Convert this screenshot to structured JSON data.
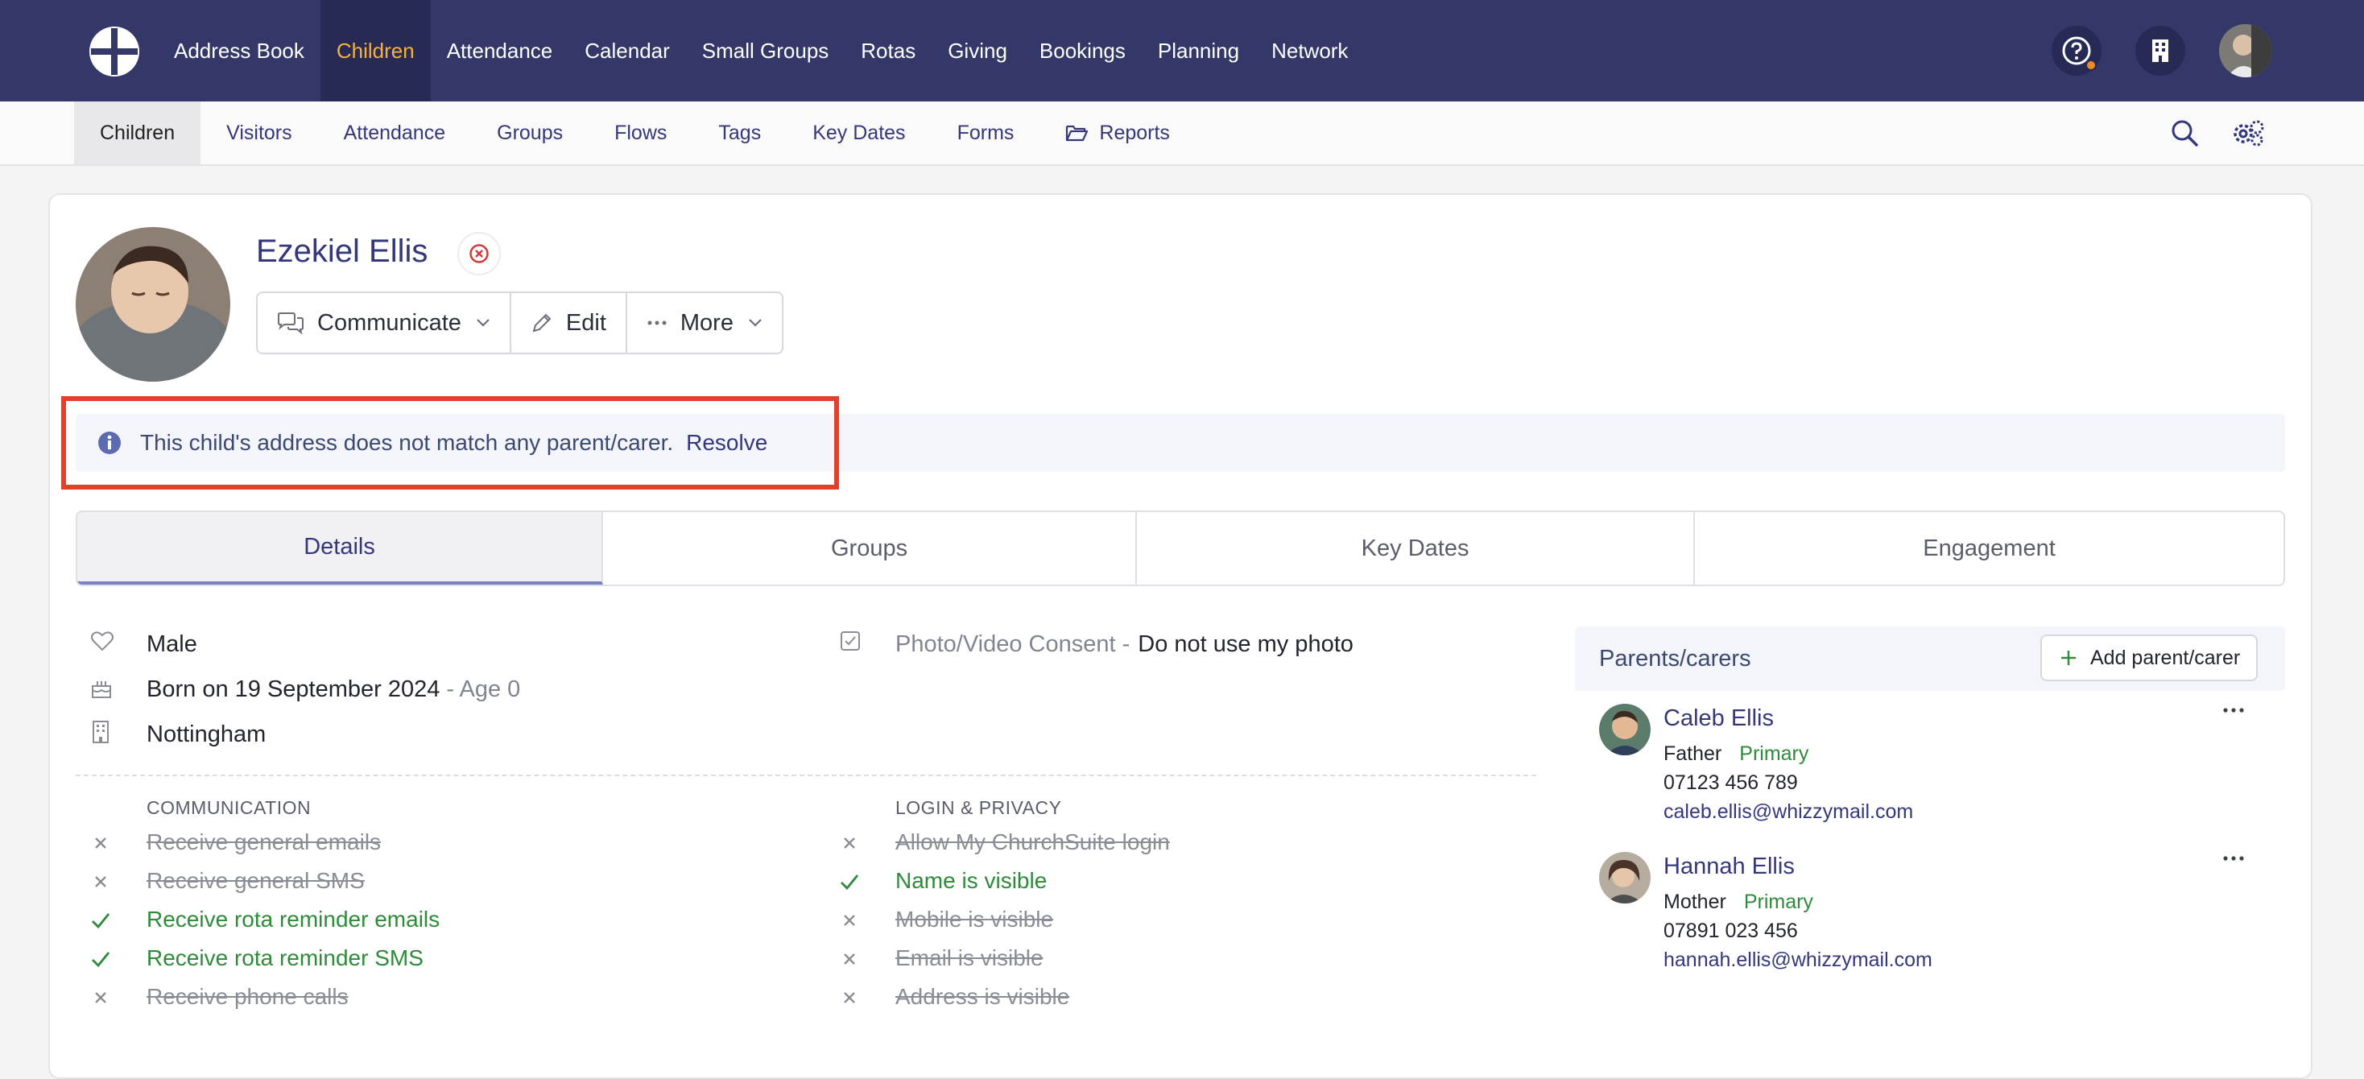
{
  "topnav": {
    "items": [
      "Address Book",
      "Children",
      "Attendance",
      "Calendar",
      "Small Groups",
      "Rotas",
      "Giving",
      "Bookings",
      "Planning",
      "Network"
    ],
    "active_index": 1
  },
  "subnav": {
    "items": [
      "Children",
      "Visitors",
      "Attendance",
      "Groups",
      "Flows",
      "Tags",
      "Key Dates",
      "Forms",
      "Reports"
    ],
    "active_index": 0
  },
  "child": {
    "name": "Ezekiel Ellis"
  },
  "actions": {
    "communicate": "Communicate",
    "edit": "Edit",
    "more": "More"
  },
  "alert": {
    "message": "This child's address does not match any parent/carer.",
    "resolve": "Resolve"
  },
  "tabs": [
    "Details",
    "Groups",
    "Key Dates",
    "Engagement"
  ],
  "details": {
    "gender": "Male",
    "born": "Born on 19 September 2024",
    "age": "- Age 0",
    "site": "Nottingham",
    "consent_label": "Photo/Video Consent -",
    "consent_value": "Do not use my photo"
  },
  "communication": {
    "heading": "COMMUNICATION",
    "items": [
      {
        "label": "Receive general emails",
        "enabled": false
      },
      {
        "label": "Receive general SMS",
        "enabled": false
      },
      {
        "label": "Receive rota reminder emails",
        "enabled": true
      },
      {
        "label": "Receive rota reminder SMS",
        "enabled": true
      },
      {
        "label": "Receive phone calls",
        "enabled": false
      }
    ]
  },
  "privacy": {
    "heading": "LOGIN & PRIVACY",
    "items": [
      {
        "label": "Allow My ChurchSuite login",
        "enabled": false
      },
      {
        "label": "Name is visible",
        "enabled": true
      },
      {
        "label": "Mobile is visible",
        "enabled": false
      },
      {
        "label": "Email is visible",
        "enabled": false
      },
      {
        "label": "Address is visible",
        "enabled": false
      }
    ]
  },
  "parents": {
    "title": "Parents/carers",
    "add_label": "Add parent/carer",
    "list": [
      {
        "name": "Caleb Ellis",
        "relation": "Father",
        "badge": "Primary",
        "phone": "07123 456 789",
        "email": "caleb.ellis@whizzymail.com"
      },
      {
        "name": "Hannah Ellis",
        "relation": "Mother",
        "badge": "Primary",
        "phone": "07891 023 456",
        "email": "hannah.ellis@whizzymail.com"
      }
    ]
  },
  "colors": {
    "topbar": "#343868",
    "active_nav": "#f3b23c",
    "enabled": "#2e8b3a",
    "highlight": "#e3402c"
  }
}
